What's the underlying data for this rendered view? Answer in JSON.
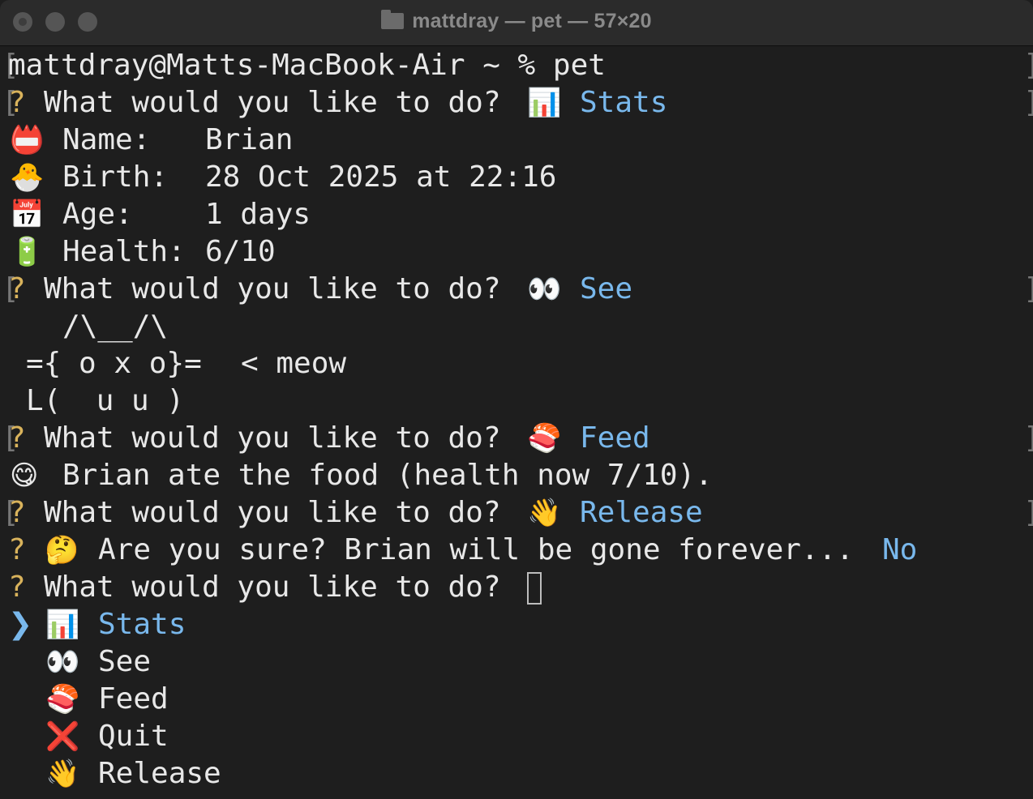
{
  "window": {
    "title": "mattdray — pet — 57×20"
  },
  "terminal": {
    "prompt_line": "mattdray@Matts-MacBook-Air ~ % pet",
    "q_mark": "?",
    "question": "What would you like to do?",
    "answer_stats": "Stats",
    "stats": {
      "name_label": "Name:",
      "name_value": "Brian",
      "birth_label": "Birth:",
      "birth_value": "28 Oct 2025 at 22:16",
      "age_label": "Age:",
      "age_value": "1 days",
      "health_label": "Health:",
      "health_value": "6/10"
    },
    "answer_see": "See",
    "cat": {
      "line1": "/\\__/\\",
      "line2": "={ o x o}=",
      "speech": "< meow",
      "line3": "L(  u u )"
    },
    "answer_feed": "Feed",
    "feed_result": "Brian ate the food (health now 7/10).",
    "answer_release": "Release",
    "confirm_question": "Are you sure? Brian will be gone forever...",
    "confirm_answer": "No",
    "menu": {
      "selector": "❯",
      "items": [
        "Stats",
        "See",
        "Feed",
        "Quit",
        "Release"
      ]
    },
    "icons": {
      "stats": "bar-chart-icon",
      "see": "eyes-icon",
      "feed": "sushi-icon",
      "quit": "cross-mark-icon",
      "release": "waving-hand-icon",
      "name": "name-badge-icon",
      "birth": "hatching-chick-icon",
      "age": "calendar-icon",
      "health": "battery-icon",
      "yum": "yum-face-icon",
      "thinking": "thinking-face-icon"
    },
    "colors": {
      "answer": "#79b8ec",
      "question_mark": "#d9b35c",
      "text": "#e8e8e8",
      "background": "#1e1e1e"
    }
  }
}
